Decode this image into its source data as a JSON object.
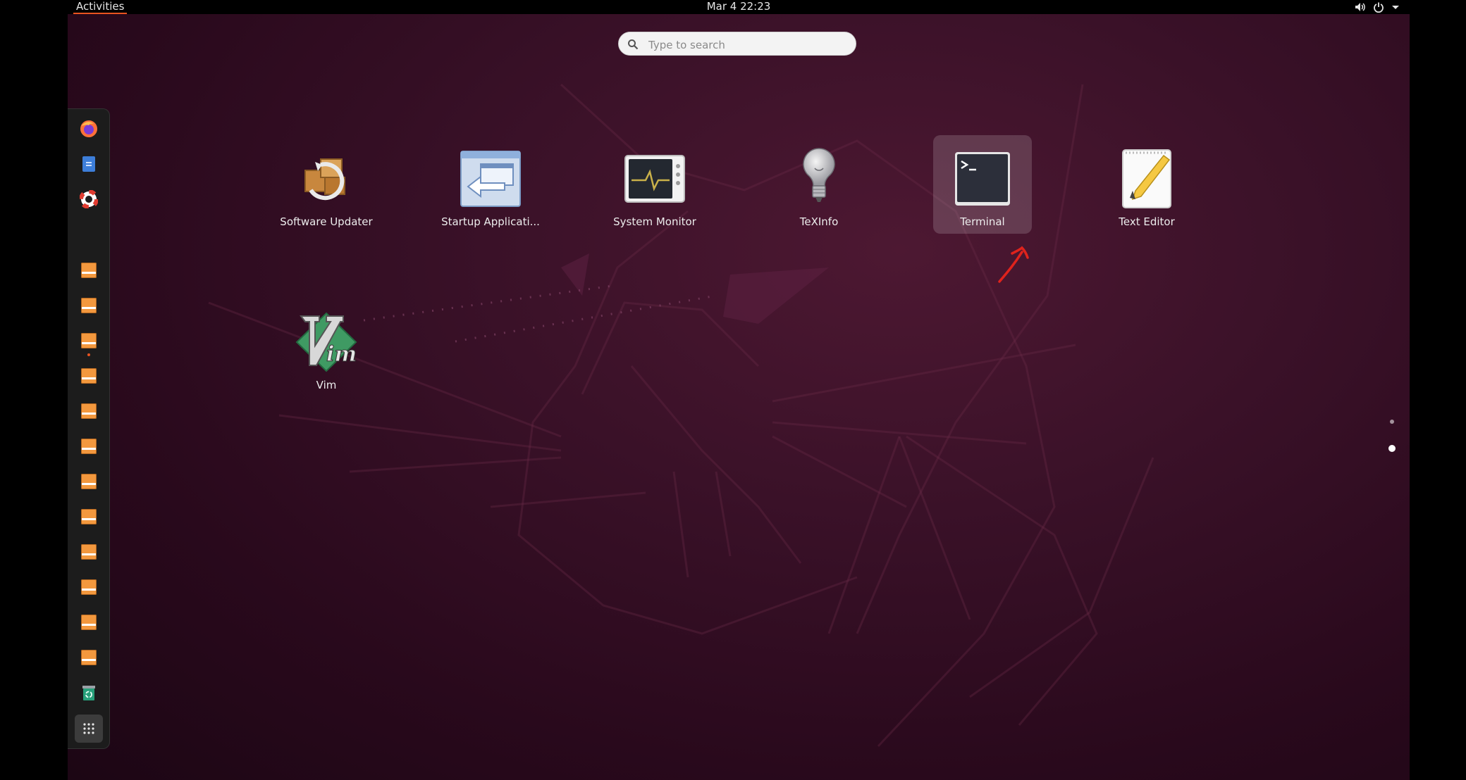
{
  "topbar": {
    "activities_label": "Activities",
    "clock": "Mar 4  22:23",
    "tray_icons": [
      "volume-icon",
      "power-icon",
      "menu-arrow-icon"
    ]
  },
  "search": {
    "placeholder": "Type to search",
    "value": ""
  },
  "dash": {
    "items": [
      {
        "name": "firefox-icon"
      },
      {
        "name": "files-icon"
      },
      {
        "name": "help-icon"
      },
      {
        "name": "disk-drive-icon"
      },
      {
        "name": "disk-drive-icon"
      },
      {
        "name": "disk-drive-icon"
      },
      {
        "name": "disk-drive-icon"
      },
      {
        "name": "disk-drive-icon"
      },
      {
        "name": "disk-drive-icon"
      },
      {
        "name": "disk-drive-icon"
      },
      {
        "name": "disk-drive-icon"
      },
      {
        "name": "disk-drive-icon"
      },
      {
        "name": "disk-drive-icon"
      },
      {
        "name": "disk-drive-icon"
      },
      {
        "name": "disk-drive-icon"
      },
      {
        "name": "trash-icon"
      },
      {
        "name": "show-applications-icon"
      }
    ]
  },
  "apps": [
    {
      "label": "Software Updater",
      "icon": "software-updater-icon"
    },
    {
      "label": "Startup Applicati...",
      "icon": "startup-applications-icon"
    },
    {
      "label": "System Monitor",
      "icon": "system-monitor-icon"
    },
    {
      "label": "TeXInfo",
      "icon": "texinfo-icon"
    },
    {
      "label": "Terminal",
      "icon": "terminal-icon",
      "selected": true
    },
    {
      "label": "Text Editor",
      "icon": "text-editor-icon"
    },
    {
      "label": "Vim",
      "icon": "vim-icon"
    }
  ],
  "page_indicator": {
    "pages": 2,
    "current": 2
  },
  "colors": {
    "accent": "#e95420",
    "annotation": "#e0231c",
    "wallpaper": "#2c0a1e"
  }
}
